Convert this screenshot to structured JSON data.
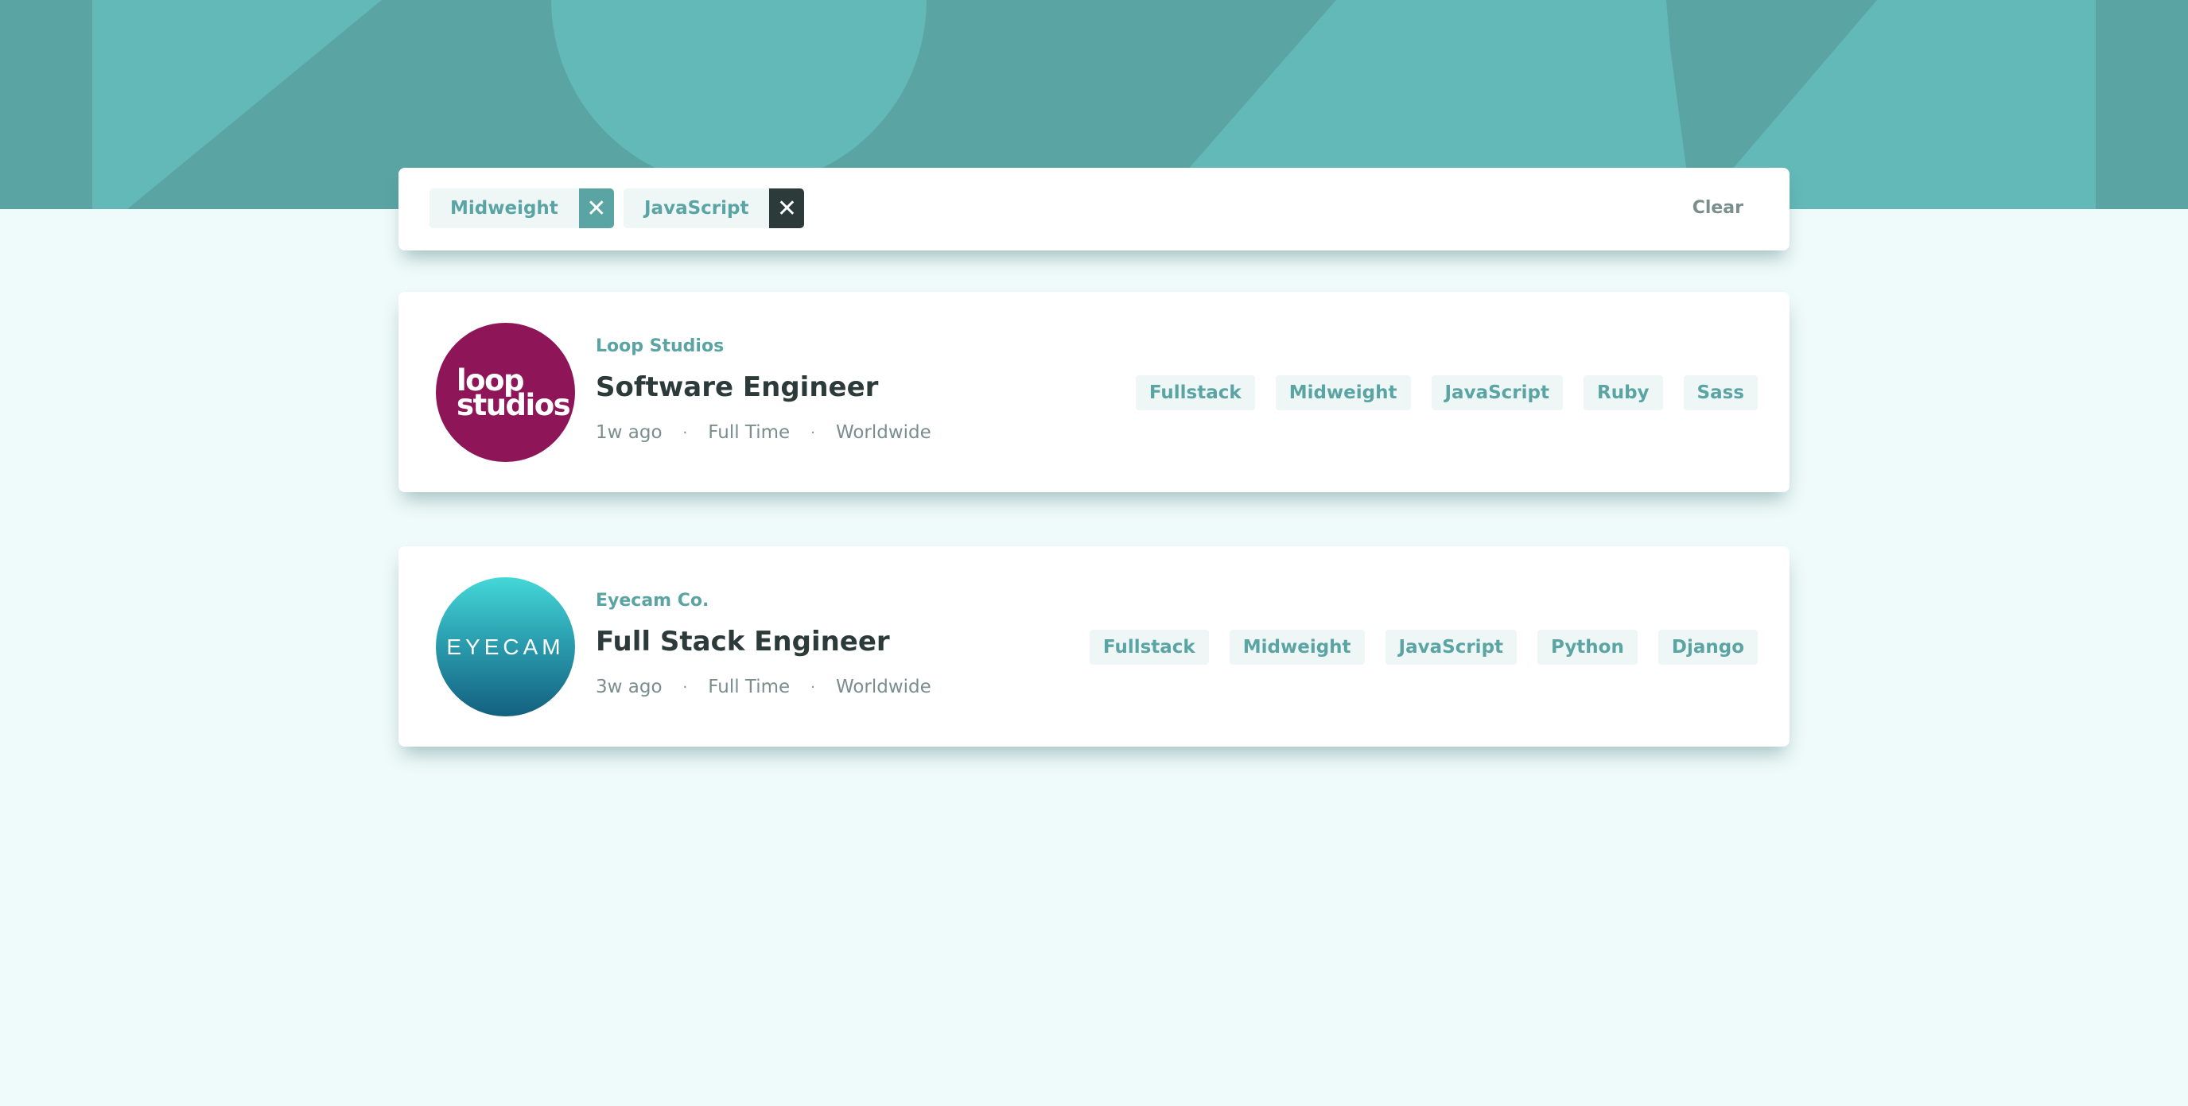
{
  "theme": {
    "header_color": "#5ba4a4",
    "header_shape_color": "#63b8b8",
    "background_color": "#effafa",
    "primary_text": "#2c3a3a",
    "accent": "#5ba4a4",
    "muted_text": "#7b8e8e",
    "tag_background": "#eef6f6"
  },
  "filters": {
    "active": [
      {
        "label": "Midweight",
        "remove_icon": "close-icon"
      },
      {
        "label": "JavaScript",
        "remove_icon": "close-icon"
      }
    ],
    "clear_label": "Clear"
  },
  "jobs": [
    {
      "company": "Loop Studios",
      "logo_text_line1": "loop",
      "logo_text_line2": "studios",
      "logo_color": "#8e1658",
      "position": "Software Engineer",
      "posted": "1w ago",
      "contract": "Full Time",
      "location": "Worldwide",
      "tags": [
        "Fullstack",
        "Midweight",
        "JavaScript",
        "Ruby",
        "Sass"
      ]
    },
    {
      "company": "Eyecam Co.",
      "logo_text": "EYECAM",
      "position": "Full Stack Engineer",
      "posted": "3w ago",
      "contract": "Full Time",
      "location": "Worldwide",
      "tags": [
        "Fullstack",
        "Midweight",
        "JavaScript",
        "Python",
        "Django"
      ]
    }
  ],
  "separator": "·"
}
